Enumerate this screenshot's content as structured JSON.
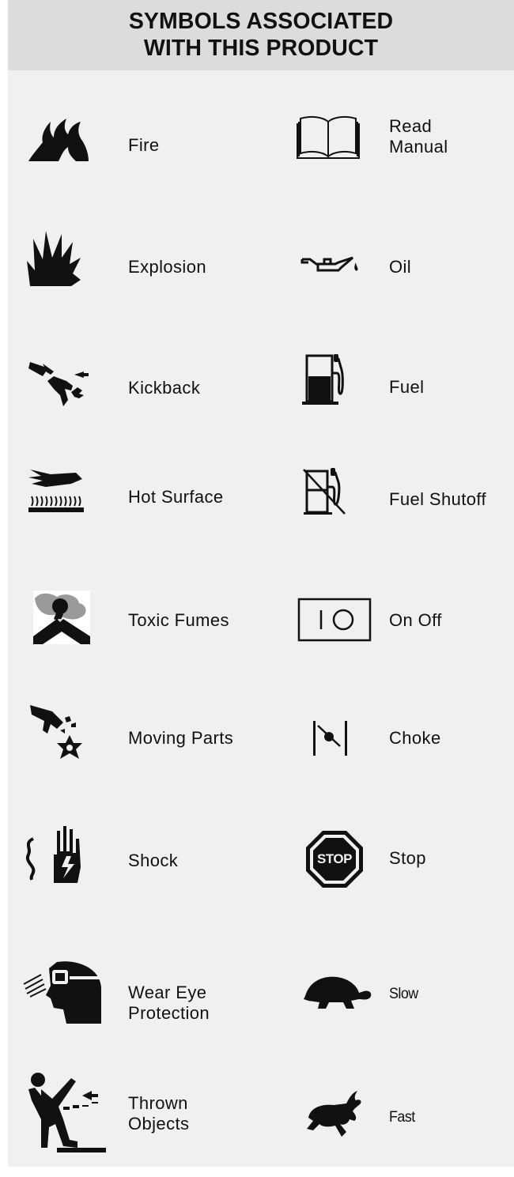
{
  "header": {
    "line1": "SYMBOLS ASSOCIATED",
    "line2": "WITH THIS PRODUCT"
  },
  "left_column": [
    {
      "icon": "fire-icon",
      "label": "Fire"
    },
    {
      "icon": "explosion-icon",
      "label": "Explosion"
    },
    {
      "icon": "kickback-icon",
      "label": "Kickback"
    },
    {
      "icon": "hot-surface-icon",
      "label": "Hot Surface"
    },
    {
      "icon": "toxic-fumes-icon",
      "label": "Toxic Fumes"
    },
    {
      "icon": "moving-parts-icon",
      "label": "Moving Parts"
    },
    {
      "icon": "shock-icon",
      "label": "Shock"
    },
    {
      "icon": "eye-protection-icon",
      "label_line1": "Wear Eye",
      "label_line2": "Protection"
    },
    {
      "icon": "thrown-objects-icon",
      "label_line1": "Thrown",
      "label_line2": "Objects"
    }
  ],
  "right_column": [
    {
      "icon": "read-manual-icon",
      "label_line1": "Read",
      "label_line2": "Manual"
    },
    {
      "icon": "oil-can-icon",
      "label": "Oil"
    },
    {
      "icon": "fuel-pump-icon",
      "label": "Fuel"
    },
    {
      "icon": "fuel-shutoff-icon",
      "label": "Fuel Shutoff"
    },
    {
      "icon": "on-off-icon",
      "label": "On Off"
    },
    {
      "icon": "choke-icon",
      "label": "Choke"
    },
    {
      "icon": "stop-sign-icon",
      "label": "Stop",
      "sign_text": "STOP"
    },
    {
      "icon": "turtle-icon",
      "label": "Slow"
    },
    {
      "icon": "rabbit-icon",
      "label": "Fast"
    }
  ],
  "colors": {
    "header_bg": "#dcdcdc",
    "panel_bg": "#f0f0f0",
    "ink": "#111111"
  }
}
